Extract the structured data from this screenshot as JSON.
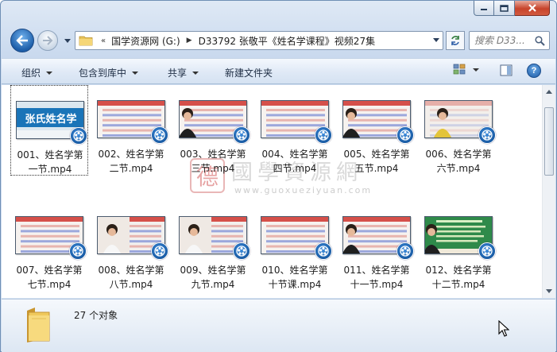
{
  "address": {
    "crumbs": [
      "国学资源网 (G:)",
      "D33792 张敬平《姓名学课程》视频27集"
    ]
  },
  "search": {
    "placeholder": "搜索 D33..."
  },
  "toolbar": {
    "organize": "组织",
    "include_in_library": "包含到库中",
    "share": "共享",
    "new_folder": "新建文件夹"
  },
  "files": [
    {
      "line1": "001、姓名学第",
      "line2": "一节.mp4"
    },
    {
      "line1": "002、姓名学第",
      "line2": "二节.mp4"
    },
    {
      "line1": "003、姓名学第",
      "line2": "三节.mp4"
    },
    {
      "line1": "004、姓名学第",
      "line2": "四节.mp4"
    },
    {
      "line1": "005、姓名学第",
      "line2": "五节.mp4"
    },
    {
      "line1": "006、姓名学第",
      "line2": "六节.mp4"
    },
    {
      "line1": "007、姓名学第",
      "line2": "七节.mp4"
    },
    {
      "line1": "008、姓名学第",
      "line2": "八节.mp4"
    },
    {
      "line1": "009、姓名学第",
      "line2": "九节.mp4"
    },
    {
      "line1": "010、姓名学第",
      "line2": "十节课.mp4"
    },
    {
      "line1": "011、姓名学第",
      "line2": "十一节.mp4"
    },
    {
      "line1": "012、姓名学第",
      "line2": "十二节.mp4"
    }
  ],
  "thumb_banner_text": "张氏姓名学",
  "watermark": {
    "seal": "德",
    "title": "國學資源網",
    "url": "www.guoxueziyuan.com"
  },
  "status": {
    "item_count": "27 个对象"
  },
  "colors": {
    "accent": "#1d5ea9",
    "toolbar_text": "#1e2d44",
    "close_button": "#c7432b"
  }
}
